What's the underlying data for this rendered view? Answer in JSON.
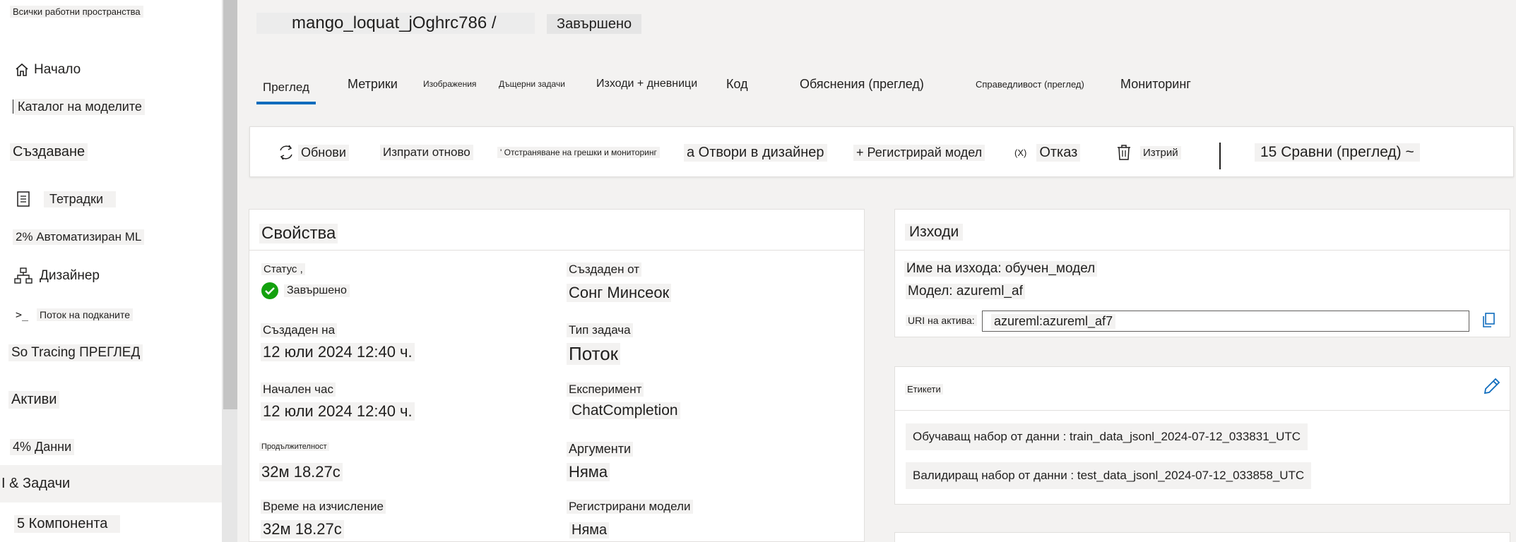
{
  "sidebar": {
    "workspace_link": "Всички работни пространства",
    "items": [
      {
        "label": "Начало",
        "icon": "home-icon"
      },
      {
        "label": "Каталог на моделите",
        "icon": ""
      },
      {
        "label": "Създаване",
        "icon": ""
      },
      {
        "label": "Тетрадки",
        "icon": "notebook-icon"
      },
      {
        "label": "2% Автоматизиран ML",
        "icon": ""
      },
      {
        "label": "Дизайнер",
        "icon": "designer-icon"
      },
      {
        "label": "Поток на подканите",
        "icon": "prompt-flow-icon"
      },
      {
        "label": "So Tracing ПРЕГЛЕД",
        "icon": ""
      },
      {
        "label": "Активи",
        "icon": ""
      },
      {
        "label": "4% Данни",
        "icon": ""
      },
      {
        "label": "I & Задачи",
        "icon": ""
      },
      {
        "label": "5 Компонента",
        "icon": ""
      }
    ]
  },
  "header": {
    "run_name": "mango_loquat_jOghrc786 /",
    "status": "Завършено"
  },
  "tabs": [
    {
      "label": "Преглед"
    },
    {
      "label": "Метрики"
    },
    {
      "label": "Изображения"
    },
    {
      "label": "Дъщерни задачи"
    },
    {
      "label": "Изходи + дневници"
    },
    {
      "label": "Код"
    },
    {
      "label": "Обяснения (преглед)"
    },
    {
      "label": "Справедливост (преглед)"
    },
    {
      "label": "Мониторинг"
    }
  ],
  "toolbar": {
    "refresh": "Обнови",
    "resubmit": "Изпрати отново",
    "debug": "' Отстраняване на грешки и мониторинг",
    "open_designer": "а Отвори в дизайнер",
    "register_model": "+ Регистрирай модел",
    "cancel_icon_text": "(X)",
    "cancel": "Отказ",
    "delete": "Изтрий",
    "compare": "15 Сравни (преглед) ~"
  },
  "properties": {
    "title": "Свойства",
    "status_label": "Статус ,",
    "status_value": "Завършено",
    "created_by_label": "Създаден от",
    "created_by_value": "Сонг Минсеок",
    "created_on_label": "Създаден на",
    "created_on_value": "12 юли 2024 12:40 ч.",
    "task_type_label": "Тип задача",
    "task_type_value": "Поток",
    "start_time_label": "Начален час",
    "start_time_value": "12 юли 2024 12:40 ч.",
    "experiment_label": "Експеримент",
    "experiment_value": "ChatCompletion",
    "duration_label": "Продължителност",
    "duration_value": "32м 18.27с",
    "arguments_label": "Аргументи",
    "arguments_value": "Няма",
    "compute_time_label": "Време на изчисление",
    "compute_time_value": "32м 18.27с",
    "registered_models_label": "Регистрирани модели",
    "registered_models_value": "Няма"
  },
  "outputs": {
    "title": "Изходи",
    "output_name": "Име на изхода: обучен_модел",
    "model": "Модел: azureml_af",
    "asset_uri_label": "URI на актива:",
    "asset_uri_value": "azureml:azureml_af7"
  },
  "tags": {
    "title": "Етикети",
    "items": [
      "Обучаващ набор от данни : train_data_jsonl_2024-07-12_033831_UTC",
      "Валидиращ набор от данни : test_data_jsonl_2024-07-12_033858_UTC"
    ]
  },
  "colors": {
    "accent": "#0f6cbd",
    "success": "#13a10e"
  }
}
